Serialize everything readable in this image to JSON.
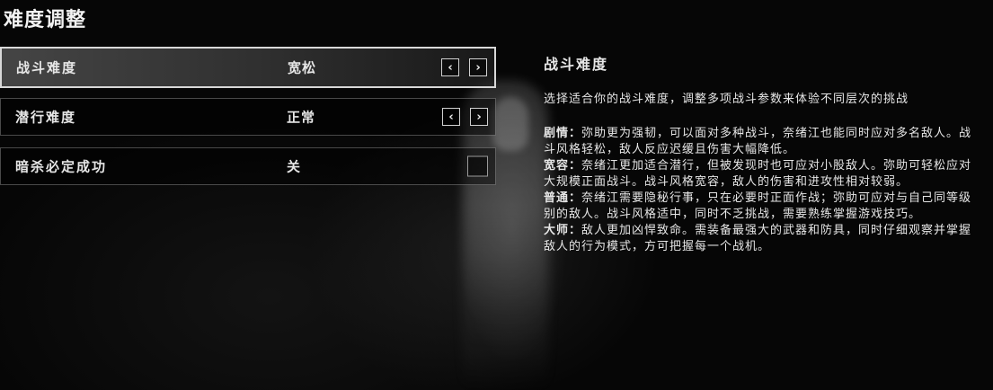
{
  "page": {
    "title": "难度调整"
  },
  "settings": [
    {
      "label": "战斗难度",
      "value": "宽松",
      "control": "arrows",
      "selected": true
    },
    {
      "label": "潜行难度",
      "value": "正常",
      "control": "arrows",
      "selected": false
    },
    {
      "label": "暗杀必定成功",
      "value": "关",
      "control": "checkbox",
      "selected": false
    }
  ],
  "arrows": {
    "prev_glyph": "‹",
    "next_glyph": "›"
  },
  "description": {
    "title": "战斗难度",
    "intro": "选择适合你的战斗难度，调整多项战斗参数来体验不同层次的挑战",
    "items": [
      {
        "term": "剧情：",
        "text": "弥助更为强韧，可以面对多种战斗，奈绪江也能同时应对多名敌人。战斗风格轻松，敌人反应迟缓且伤害大幅降低。"
      },
      {
        "term": "宽容：",
        "text": "奈绪江更加适合潜行，但被发现时也可应对小股敌人。弥助可轻松应对大规模正面战斗。战斗风格宽容，敌人的伤害和进攻性相对较弱。"
      },
      {
        "term": "普通：",
        "text": "奈绪江需要隐秘行事，只在必要时正面作战；弥助可应对与自己同等级别的敌人。战斗风格适中，同时不乏挑战，需要熟练掌握游戏技巧。"
      },
      {
        "term": "大师：",
        "text": "敌人更加凶悍致命。需装备最强大的武器和防具，同时仔细观察并掌握敌人的行为模式，方可把握每一个战机。"
      }
    ]
  },
  "colors": {
    "selected_border": "#d8d8d8",
    "text": "#e6e6e6",
    "background": "#060606"
  }
}
